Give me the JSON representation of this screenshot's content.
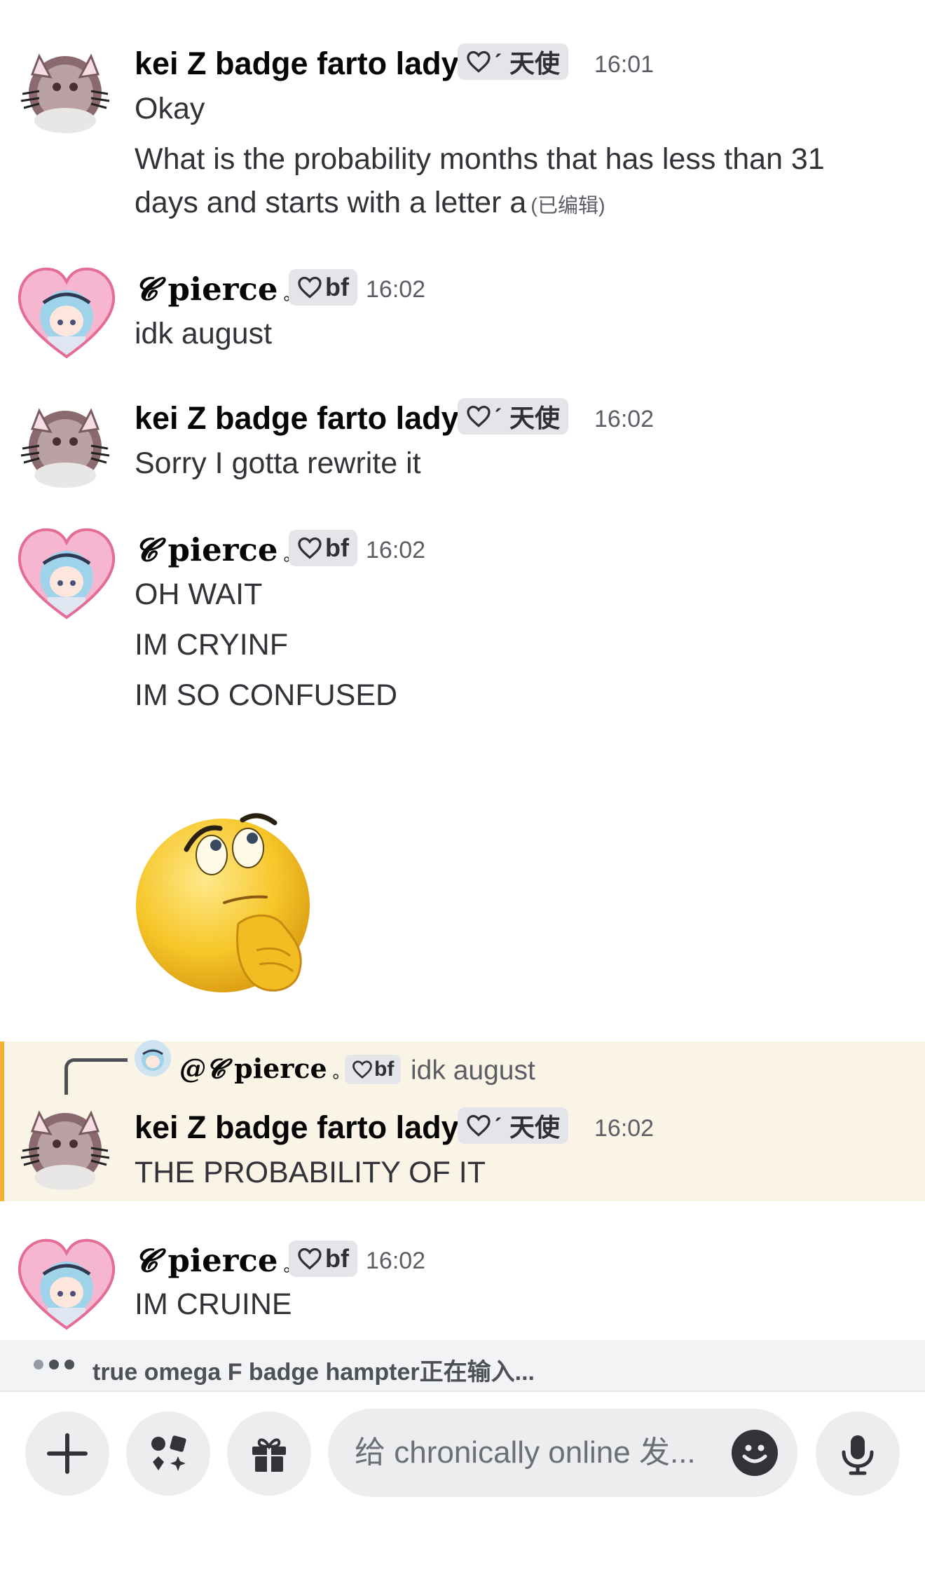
{
  "colors": {
    "accent_reply": "#f0b232",
    "highlight_bg": "#f9f4e6",
    "tag_bg": "#e3e5e8"
  },
  "messages": [
    {
      "author": "kei Z badge farto lady",
      "tag": "ˊ 天使",
      "time": "16:01",
      "lines": [
        "Okay",
        "What is the probability months that has less than 31",
        "days and starts with a letter a"
      ],
      "edited": "(已编辑)"
    },
    {
      "author_symbol": "𝓒",
      "author": "pierce",
      "author_dot": "。",
      "tag": "bf",
      "time": "16:02",
      "lines": [
        "idk august"
      ]
    },
    {
      "author": "kei Z badge farto lady",
      "tag": "ˊ 天使",
      "time": "16:02",
      "lines": [
        "Sorry I gotta rewrite it"
      ]
    },
    {
      "author_symbol": "𝓒",
      "author": "pierce",
      "author_dot": "。",
      "tag": "bf",
      "time": "16:02",
      "lines": [
        "OH WAIT",
        "IM CRYINF",
        "IM SO CONFUSED"
      ],
      "sticker": "thinking-emoji"
    },
    {
      "reply_to": {
        "author_symbol": "@𝓒",
        "author": "pierce",
        "author_dot": "。",
        "tag": "bf",
        "text": "idk august"
      },
      "author": "kei Z badge farto lady",
      "tag": "ˊ 天使",
      "time": "16:02",
      "lines": [
        "THE PROBABILITY OF IT"
      ]
    },
    {
      "author_symbol": "𝓒",
      "author": "pierce",
      "author_dot": "。",
      "tag": "bf",
      "time": "16:02",
      "lines": [
        "IM CRUINE"
      ]
    }
  ],
  "typing": {
    "text": "true omega F badge hampter正在输入..."
  },
  "composer": {
    "placeholder": "给 chronically online 发...",
    "buttons": [
      "plus-icon",
      "apps-icon",
      "gift-icon",
      "emoji-icon",
      "microphone-icon"
    ]
  }
}
